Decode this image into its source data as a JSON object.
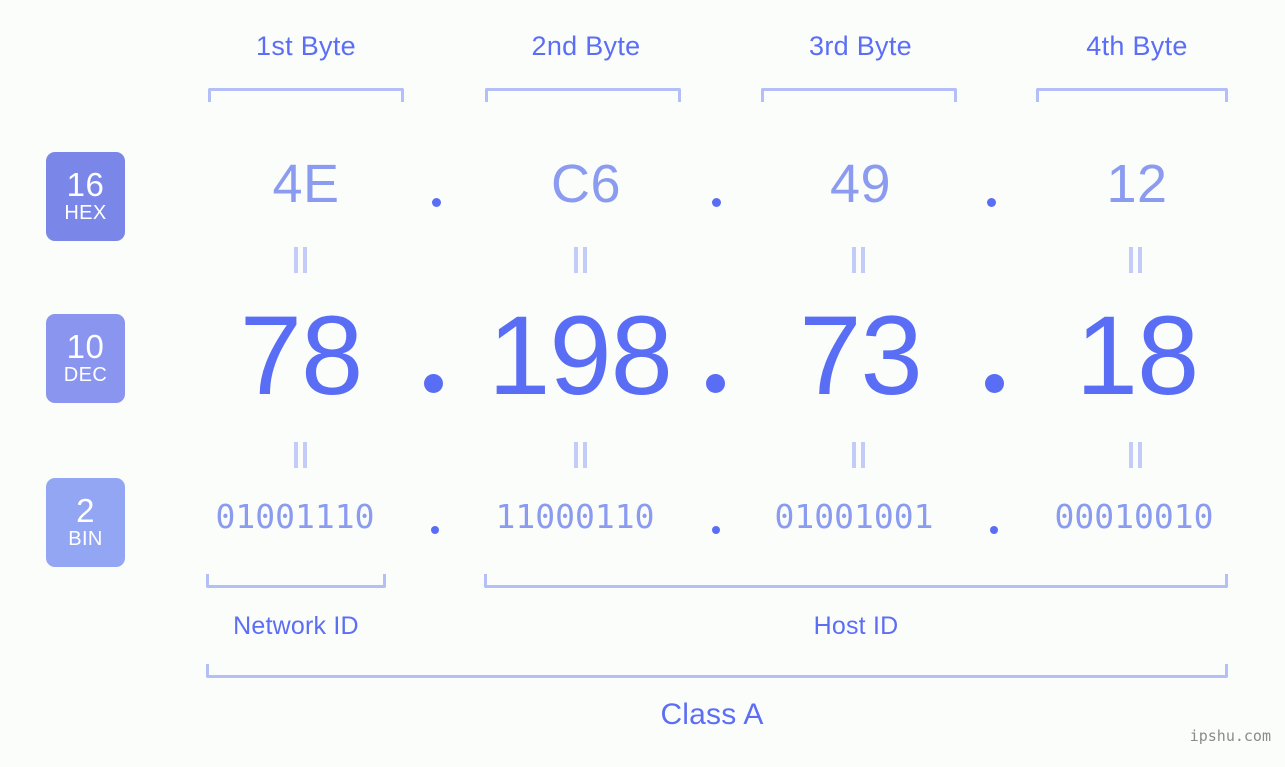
{
  "page": {
    "background_color": "#fbfdfa",
    "accent_color": "#5a6ef5",
    "light_accent_color": "#8b9bef",
    "bracket_color": "#b4bff7",
    "watermark": "ipshu.com"
  },
  "byte_headers": [
    {
      "label": "1st Byte"
    },
    {
      "label": "2nd Byte"
    },
    {
      "label": "3rd Byte"
    },
    {
      "label": "4th Byte"
    }
  ],
  "bases": [
    {
      "number": "16",
      "name": "HEX",
      "color": "#7b87e8"
    },
    {
      "number": "10",
      "name": "DEC",
      "color": "#8a95ef"
    },
    {
      "number": "2",
      "name": "BIN",
      "color": "#93a6f4"
    }
  ],
  "rows": {
    "hex": {
      "octets": [
        "4E",
        "C6",
        "49",
        "12"
      ],
      "separator": "."
    },
    "dec": {
      "octets": [
        "78",
        "198",
        "73",
        "18"
      ],
      "separator": "."
    },
    "bin": {
      "octets": [
        "01001110",
        "11000110",
        "01001001",
        "00010010"
      ],
      "separator": "."
    }
  },
  "segments": {
    "network_id": "Network ID",
    "host_id": "Host ID",
    "class": "Class A"
  },
  "address": {
    "hex": "4E.C6.49.12",
    "dec": "78.198.73.18",
    "bin": "01001110.11000110.01001001.00010010"
  }
}
